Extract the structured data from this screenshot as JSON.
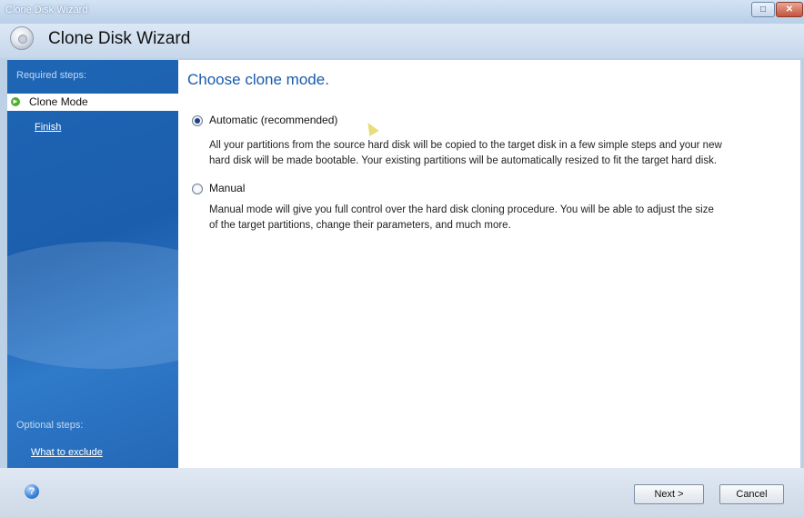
{
  "window": {
    "title": "Clone Disk Wizard",
    "restore_icon": "restore-icon",
    "close_icon": "close-icon"
  },
  "header": {
    "title": "Clone Disk Wizard"
  },
  "sidebar": {
    "required_heading": "Required steps:",
    "items": [
      {
        "label": "Clone Mode",
        "active": true
      },
      {
        "label": "Finish",
        "active": false
      }
    ],
    "optional_heading": "Optional steps:",
    "optional_items": [
      {
        "label": "What to exclude"
      }
    ]
  },
  "main": {
    "title": "Choose clone mode.",
    "options": [
      {
        "label": "Automatic (recommended)",
        "checked": true,
        "desc_line1": "All your partitions from the source hard disk will be copied to the target disk in a few simple steps and your new",
        "desc_line2": "hard disk will be made bootable. Your existing partitions will be automatically resized to fit the target hard disk."
      },
      {
        "label": "Manual",
        "checked": false,
        "desc_line1": "Manual mode will give you full control over the hard disk cloning procedure. You will be able to adjust the size",
        "desc_line2": "of the target partitions, change their parameters, and much more."
      }
    ]
  },
  "footer": {
    "next_label": "Next >",
    "cancel_label": "Cancel"
  },
  "colors": {
    "accent": "#1a5aab",
    "sidebar": "#1e66b5",
    "active_item_bg": "#ffffff"
  }
}
